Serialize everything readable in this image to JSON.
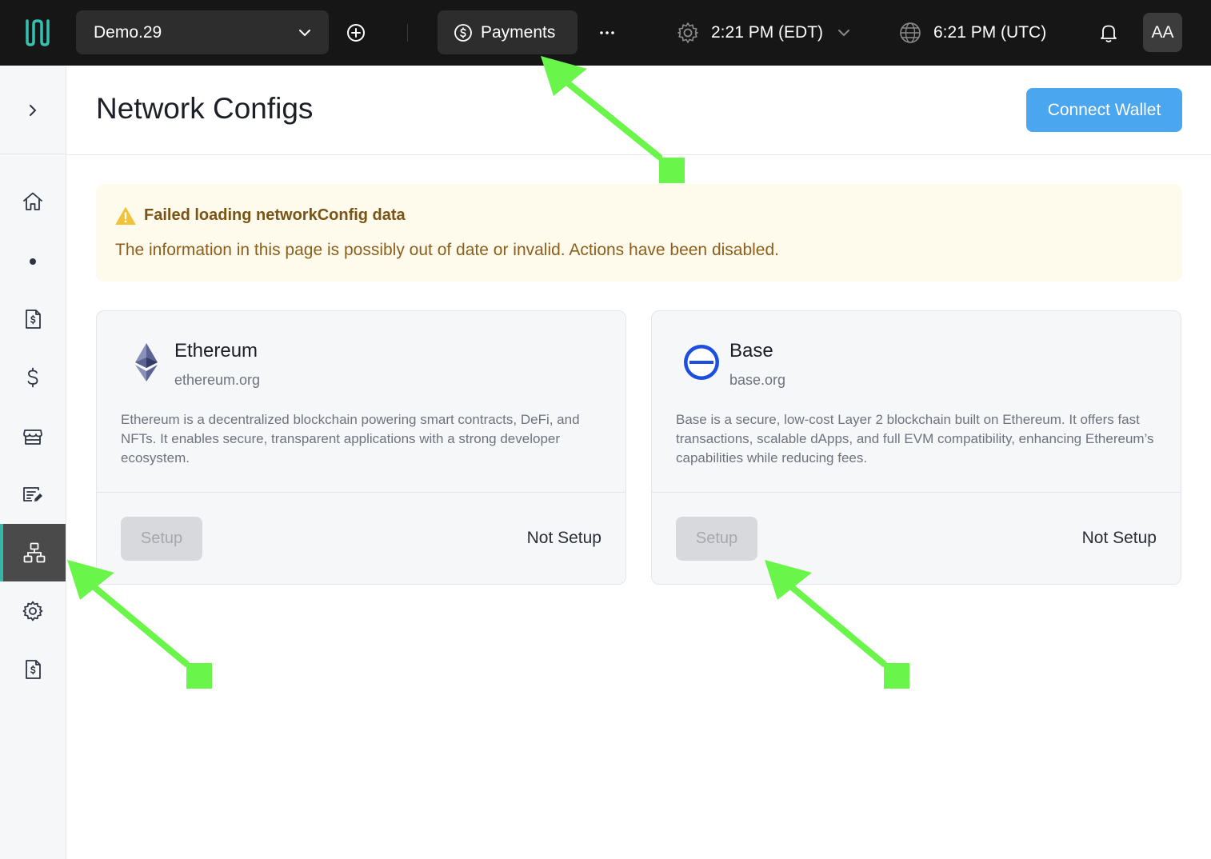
{
  "topbar": {
    "org_name": "Demo.29",
    "payments_label": "Payments",
    "local_time": "2:21 PM (EDT)",
    "utc_time": "6:21 PM (UTC)",
    "avatar_initials": "AA"
  },
  "sidebar": {
    "items": [
      {
        "icon": "home-icon"
      },
      {
        "icon": "dot-icon"
      },
      {
        "icon": "invoice-icon"
      },
      {
        "icon": "dollar-icon"
      },
      {
        "icon": "store-icon"
      },
      {
        "icon": "edit-form-icon"
      },
      {
        "icon": "network-icon",
        "active": true
      },
      {
        "icon": "gear-icon"
      },
      {
        "icon": "invoice-icon"
      }
    ]
  },
  "page": {
    "title": "Network Configs",
    "connect_wallet_label": "Connect Wallet"
  },
  "alert": {
    "title": "Failed loading networkConfig data",
    "body": "The information in this page is possibly out of date or invalid. Actions have been disabled."
  },
  "networks": [
    {
      "name": "Ethereum",
      "site": "ethereum.org",
      "description": "Ethereum is a decentralized blockchain powering smart contracts, DeFi, and NFTs. It enables secure, transparent applications with a strong developer ecosystem.",
      "setup_label": "Setup",
      "status": "Not Setup"
    },
    {
      "name": "Base",
      "site": "base.org",
      "description": "Base is a secure, low-cost Layer 2 blockchain built on Ethereum. It offers fast transactions, scalable dApps, and full EVM compatibility, enhancing Ethereum’s capabilities while reducing fees.",
      "setup_label": "Setup",
      "status": "Not Setup"
    }
  ],
  "colors": {
    "accent": "#4aa6ef",
    "topbar": "#161616",
    "alert_bg": "#fefaec",
    "annotation": "#6af54a"
  }
}
